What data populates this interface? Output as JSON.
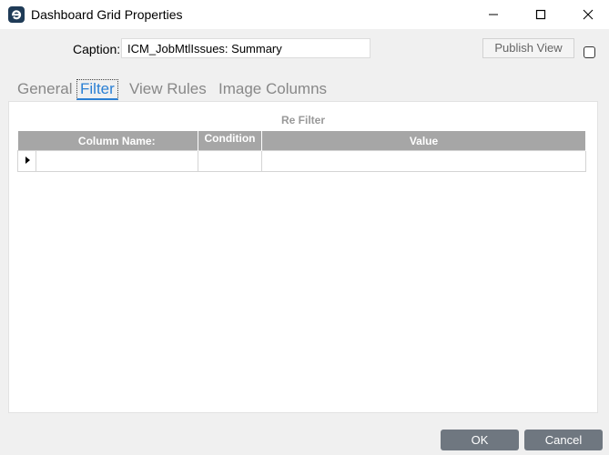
{
  "window": {
    "title": "Dashboard Grid Properties"
  },
  "caption": {
    "label": "Caption:",
    "value": "ICM_JobMtlIssues: Summary"
  },
  "publish": {
    "label": "Publish View",
    "checked": false
  },
  "tabs": [
    {
      "label": "General",
      "active": false
    },
    {
      "label": "Filter",
      "active": true
    },
    {
      "label": "View Rules",
      "active": false
    },
    {
      "label": "Image Columns",
      "active": false
    }
  ],
  "filter": {
    "title": "Re Filter",
    "columns": [
      "Column Name:",
      "Condition",
      "Value"
    ],
    "rows": [
      {
        "column_name": "",
        "condition": "",
        "value": ""
      }
    ]
  },
  "footer": {
    "ok_label": "OK",
    "cancel_label": "Cancel"
  },
  "colors": {
    "active_tab": "#2a7fd4",
    "header_bg": "#a6a6a6",
    "footer_button": "#6f7780",
    "app_icon": "#1f3b57"
  }
}
